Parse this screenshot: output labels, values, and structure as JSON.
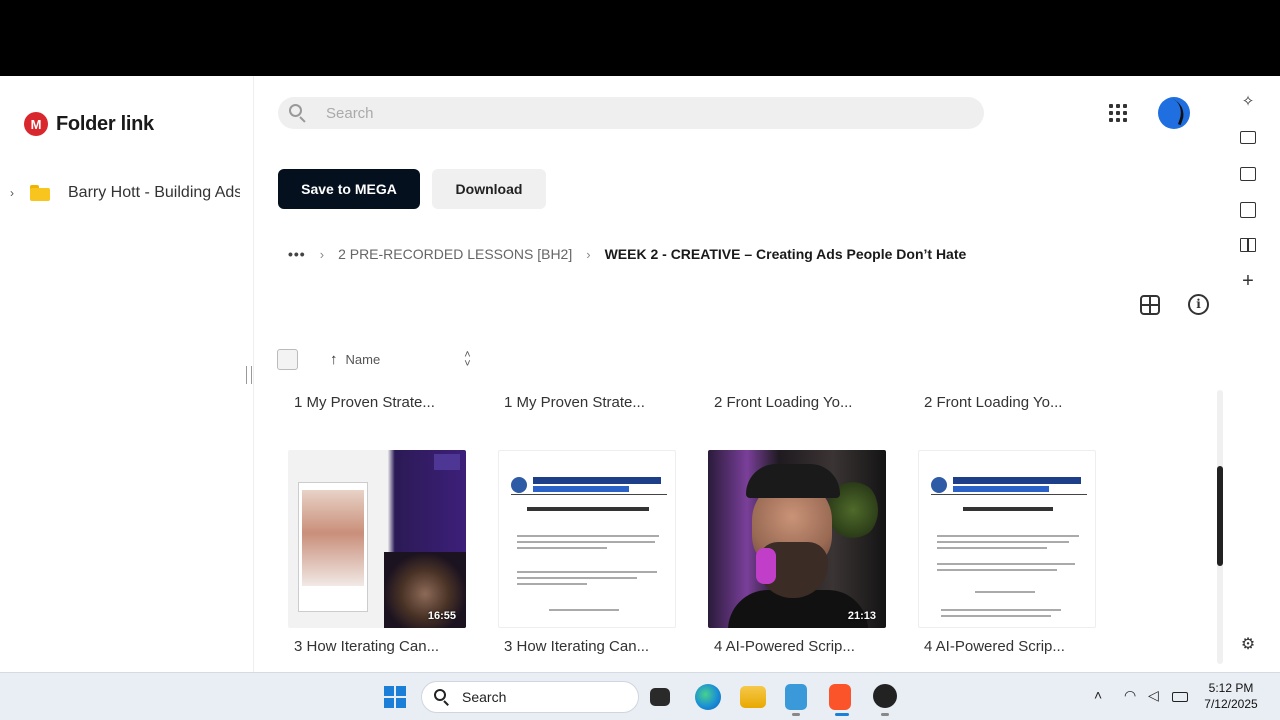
{
  "app": {
    "title": "Folder link",
    "logo_letter": "M"
  },
  "sidebar": {
    "items": [
      {
        "label": "Barry Hott - Building Ads People Don't Hate",
        "icon": "folder-icon",
        "expanded": false
      }
    ]
  },
  "header": {
    "search_placeholder": "Search",
    "apps_icon": "apps-grid-icon",
    "avatar_icon": "avatar"
  },
  "toolbar": {
    "save_label": "Save to MEGA",
    "download_label": "Download"
  },
  "breadcrumb": {
    "more": "•••",
    "items": [
      "2 PRE-RECORDED LESSONS [BH2]",
      "WEEK 2 - CREATIVE – Creating Ads People Don’t Hate"
    ]
  },
  "list": {
    "column_name": "Name",
    "sort_direction": "ascending"
  },
  "files_row1": [
    "1 My Proven Strate...",
    "1 My Proven Strate...",
    "2 Front Loading Yo...",
    "2 Front Loading Yo..."
  ],
  "files_row2": [
    {
      "label": "3 How Iterating Can...",
      "type": "video",
      "duration": "16:55"
    },
    {
      "label": "3 How Iterating Can...",
      "type": "document"
    },
    {
      "label": "4 AI-Powered Scrip...",
      "type": "video",
      "duration": "21:13"
    },
    {
      "label": "4 AI-Powered Scrip...",
      "type": "document"
    }
  ],
  "rail_icons": [
    "copilot-icon",
    "camera-icon",
    "wallet-icon",
    "bookmark-icon",
    "reading-list-icon",
    "add-icon",
    "settings-icon"
  ],
  "taskbar": {
    "search_label": "Search",
    "apps": [
      "file-manager-icon",
      "edge-icon",
      "file-explorer-icon",
      "notepad-icon",
      "brave-icon",
      "obs-icon"
    ],
    "time": "5:12 PM",
    "date": "7/12/2025"
  },
  "colors": {
    "primary_button": "#04101e",
    "mega_red": "#d9272e",
    "windows_blue": "#1b7fd8"
  }
}
